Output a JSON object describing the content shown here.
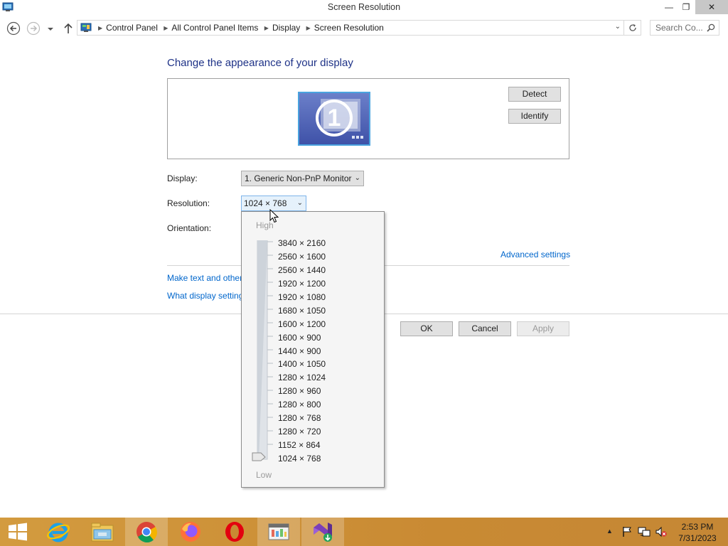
{
  "window": {
    "title": "Screen Resolution",
    "controls": {
      "minimize": "—",
      "maximize": "❐",
      "close": "✕"
    }
  },
  "address_bar": {
    "breadcrumbs": [
      "Control Panel",
      "All Control Panel Items",
      "Display",
      "Screen Resolution"
    ],
    "search_placeholder": "Search Co..."
  },
  "main": {
    "heading": "Change the appearance of your display",
    "monitor_number": "1",
    "detect_label": "Detect",
    "identify_label": "Identify",
    "display_label": "Display:",
    "display_value": "1. Generic Non-PnP Monitor",
    "resolution_label": "Resolution:",
    "resolution_value": "1024 × 768",
    "orientation_label": "Orientation:",
    "advanced_link": "Advanced settings",
    "link_text_size": "Make text and other",
    "link_which_settings": "What display setting",
    "ok_label": "OK",
    "cancel_label": "Cancel",
    "apply_label": "Apply"
  },
  "resolution_popup": {
    "high_label": "High",
    "low_label": "Low",
    "options": [
      "3840 × 2160",
      "2560 × 1600",
      "2560 × 1440",
      "1920 × 1200",
      "1920 × 1080",
      "1680 × 1050",
      "1600 × 1200",
      "1600 × 900",
      "1440 × 900",
      "1400 × 1050",
      "1280 × 1024",
      "1280 × 960",
      "1280 × 800",
      "1280 × 768",
      "1280 × 720",
      "1152 × 864",
      "1024 × 768"
    ],
    "selected_index": 16
  },
  "taskbar": {
    "apps": [
      "internet-explorer-icon",
      "file-explorer-icon",
      "chrome-icon",
      "firefox-icon",
      "opera-icon",
      "control-panel-icon",
      "visual-studio-installer-icon"
    ],
    "time": "2:53 PM",
    "date": "7/31/2023",
    "accent": "#d39b3f"
  },
  "colors": {
    "heading": "#1e3287",
    "link": "#0066cc",
    "select_focus": "#e5f1fb"
  }
}
